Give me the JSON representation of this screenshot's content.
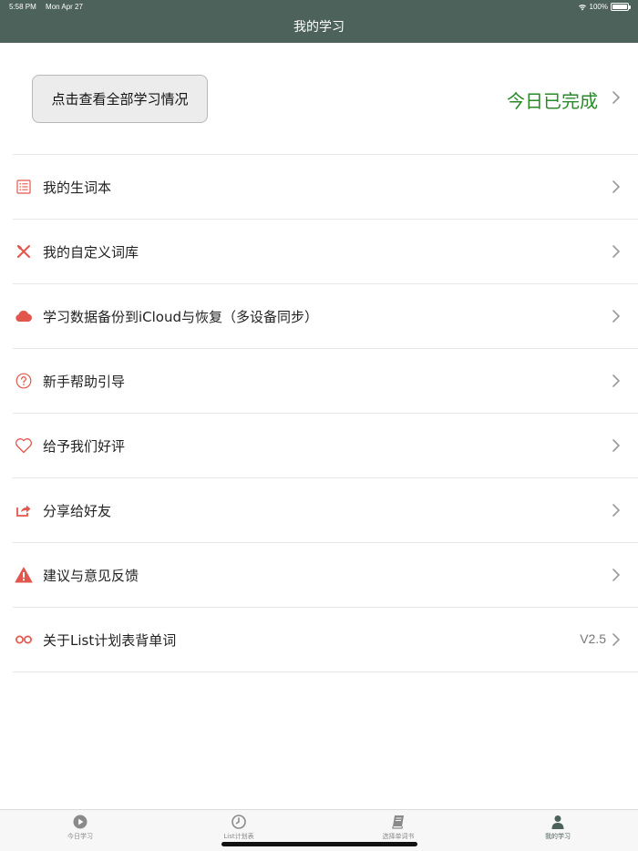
{
  "status_bar": {
    "time": "5:58 PM",
    "date": "Mon Apr 27",
    "battery": "100%"
  },
  "nav": {
    "title": "我的学习"
  },
  "summary": {
    "view_all_label": "点击查看全部学习情况",
    "today_status": "今日已完成",
    "today_color": "#2a8a2a"
  },
  "menu": [
    {
      "label": "我的生词本",
      "icon": "list-icon"
    },
    {
      "label": "我的自定义词库",
      "icon": "utensils-icon"
    },
    {
      "label": "学习数据备份到iCloud与恢复（多设备同步）",
      "icon": "cloud-icon"
    },
    {
      "label": "新手帮助引导",
      "icon": "question-circle-icon"
    },
    {
      "label": "给予我们好评",
      "icon": "heart-icon"
    },
    {
      "label": "分享给好友",
      "icon": "share-icon"
    },
    {
      "label": "建议与意见反馈",
      "icon": "warning-icon"
    },
    {
      "label": "关于List计划表背单词",
      "icon": "infinity-icon",
      "value": "V2.5"
    }
  ],
  "tabs": [
    {
      "label": "今日学习",
      "icon": "play-circle-icon",
      "active": false
    },
    {
      "label": "List计划表",
      "icon": "clock-icon",
      "active": false
    },
    {
      "label": "选择单词书",
      "icon": "book-icon",
      "active": false
    },
    {
      "label": "我的学习",
      "icon": "person-icon",
      "active": true
    }
  ],
  "colors": {
    "header": "#4d625b",
    "accent_red": "#e2574c",
    "chevron": "#9a9a9a"
  }
}
